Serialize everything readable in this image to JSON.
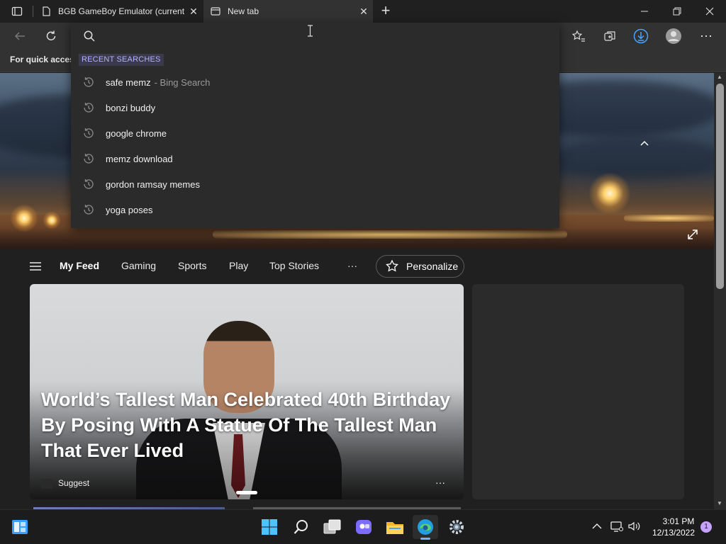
{
  "browser": {
    "tabs": [
      {
        "label": "BGB GameBoy Emulator (current"
      },
      {
        "label": "New tab"
      }
    ],
    "favorites_bar_text": "For quick access"
  },
  "search": {
    "placeholder": "",
    "value": "",
    "recent_label": "RECENT SEARCHES",
    "suggestions": [
      {
        "text": "safe memz",
        "source": "- Bing Search"
      },
      {
        "text": "bonzi buddy",
        "source": ""
      },
      {
        "text": "google chrome",
        "source": ""
      },
      {
        "text": "memz download",
        "source": ""
      },
      {
        "text": "gordon ramsay memes",
        "source": ""
      },
      {
        "text": "yoga poses",
        "source": ""
      }
    ]
  },
  "feed": {
    "nav": [
      "My Feed",
      "Gaming",
      "Sports",
      "Play",
      "Top Stories"
    ],
    "more_label": "···",
    "personalize_label": "Personalize",
    "main_card": {
      "headline": "World’s Tallest Man Celebrated 40th Birthday By Posing With A Statue Of The Tallest Man That Ever Lived",
      "source": "Suggest",
      "more": "···"
    }
  },
  "taskbar": {
    "time": "3:01 PM",
    "date": "12/13/2022",
    "notification_count": "1"
  },
  "colors": {
    "accent": "#4ba3ff",
    "recent_label": "#b3b3ff",
    "notification_badge": "#c7a3ff"
  }
}
